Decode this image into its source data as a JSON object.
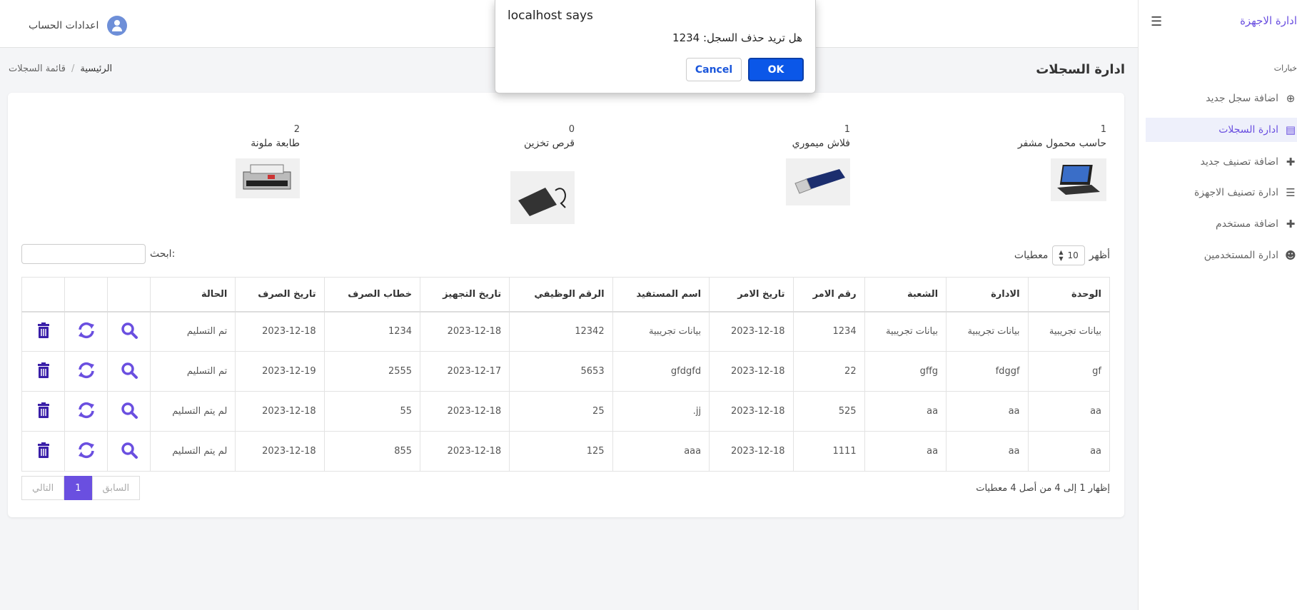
{
  "sidebar": {
    "brand": "ادارة الاجهزة",
    "section": "خيارات",
    "items": [
      {
        "label": "اضافة سجل جديد",
        "icon": "plus-circle-icon"
      },
      {
        "label": "ادارة السجلات",
        "icon": "list-alt-icon"
      },
      {
        "label": "اضافة تصنيف جديد",
        "icon": "plus-icon"
      },
      {
        "label": "ادارة تصنيف الاجهزة",
        "icon": "list-icon"
      },
      {
        "label": "اضافة مستخدم",
        "icon": "plus-icon"
      },
      {
        "label": "ادارة المستخدمين",
        "icon": "users-icon"
      }
    ]
  },
  "header": {
    "account_label": "اعدادات الحساب"
  },
  "page": {
    "title": "ادارة السجلات",
    "breadcrumb": {
      "home": "الرئيسية",
      "sep": "/",
      "current": "قائمة السجلات"
    }
  },
  "devices": [
    {
      "count": "1",
      "name": "حاسب محمول مشفر",
      "icon": "laptop-icon"
    },
    {
      "count": "1",
      "name": "فلاش ميموري",
      "icon": "usb-icon"
    },
    {
      "count": "0",
      "name": "قرص تخزين",
      "icon": "hard-drive-icon"
    },
    {
      "count": "2",
      "name": "طابعة ملونة",
      "icon": "printer-icon"
    }
  ],
  "table_controls": {
    "show_prefix": "أظهر",
    "page_size": "10",
    "show_suffix": "معطيات",
    "search_label": "ابحث:"
  },
  "table": {
    "headers": [
      "الوحدة",
      "الادارة",
      "الشعبة",
      "رقم الامر",
      "تاريخ الامر",
      "اسم المستفيد",
      "الرقم الوظيفي",
      "تاريخ التجهيز",
      "خطاب الصرف",
      "تاريخ الصرف",
      "الحالة"
    ],
    "rows": [
      [
        "بيانات تجريبية",
        "بيانات تجريبية",
        "بيانات تجريبية",
        "1234",
        "2023-12-18",
        "بيانات تجريبية",
        "12342",
        "2023-12-18",
        "1234",
        "2023-12-18",
        "تم التسليم"
      ],
      [
        "gf",
        "fdggf",
        "gffg",
        "22",
        "2023-12-18",
        "gfdgfd",
        "5653",
        "2023-12-17",
        "2555",
        "2023-12-19",
        "تم التسليم"
      ],
      [
        "aa",
        "aa",
        "aa",
        "525",
        "2023-12-18",
        "jj.",
        "25",
        "2023-12-18",
        "55",
        "2023-12-18",
        "لم يتم التسليم"
      ],
      [
        "aa",
        "aa",
        "aa",
        "1111",
        "2023-12-18",
        "aaa",
        "125",
        "2023-12-18",
        "855",
        "2023-12-18",
        "لم يتم التسليم"
      ]
    ]
  },
  "table_info": "إظهار 1 إلى 4 من أصل 4 معطيات",
  "pager": {
    "prev": "السابق",
    "page": "1",
    "next": "التالي"
  },
  "dialog": {
    "title": "localhost says",
    "message": "هل تريد حذف السجل: 1234",
    "cancel": "Cancel",
    "ok": "OK"
  },
  "colors": {
    "accent": "#6a4fe0",
    "ok_button": "#0b57e8",
    "trash": "#3a1fa8"
  }
}
